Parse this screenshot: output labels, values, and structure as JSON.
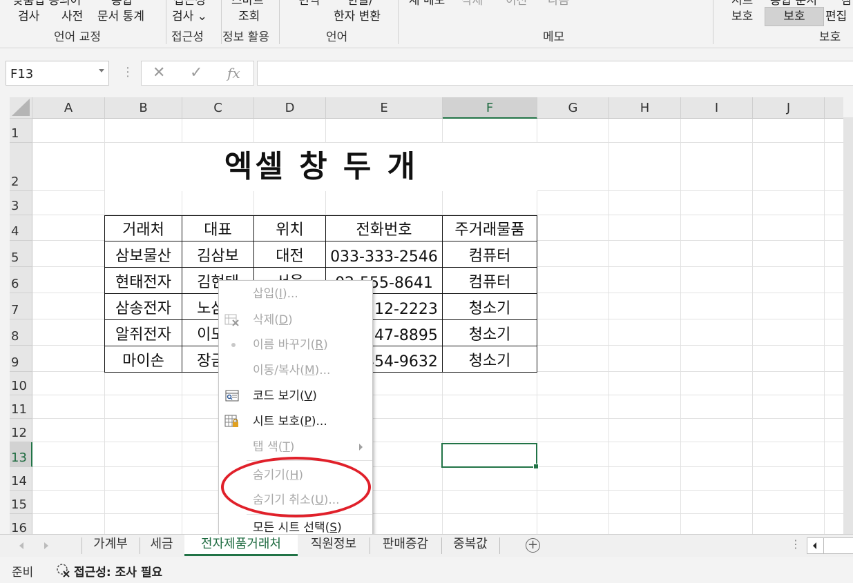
{
  "ribbon": {
    "top_cut": [
      "맞춤법 종의어",
      "통합",
      "접근성",
      "스마트",
      "번역",
      "한글/",
      "새 메모",
      "삭제",
      "이전",
      "다음",
      "시트",
      "통합 문서",
      "잠"
    ],
    "row2": {
      "spell": "검사",
      "thesaurus": "사전",
      "stats": "문서 통계",
      "accessibility": "검사 ⌄",
      "lookup": "조회",
      "hanja": "한자 변환",
      "protect_sheet": "보호",
      "protect_workbook": "보호",
      "edit": "편집"
    },
    "groups": {
      "proofing": "언어 교정",
      "accessibility": "접근성",
      "insights": "정보 활용",
      "language": "언어",
      "comments": "메모",
      "protect": "보호"
    }
  },
  "formula_bar": {
    "name_box": "F13",
    "cancel_icon": "✕",
    "enter_icon": "✓",
    "fx_label": "fx",
    "formula": ""
  },
  "grid": {
    "columns": [
      "A",
      "B",
      "C",
      "D",
      "E",
      "F",
      "G",
      "H",
      "I",
      "J"
    ],
    "rows": [
      "1",
      "2",
      "3",
      "4",
      "5",
      "6",
      "7",
      "8",
      "9",
      "10",
      "11",
      "12",
      "13",
      "14",
      "15",
      "16"
    ],
    "selected_cell": "F13"
  },
  "sheet": {
    "title": "엑셀 창 두 개",
    "headers": [
      "거래처",
      "대표",
      "위치",
      "전화번호",
      "주거래물품"
    ],
    "rows": [
      [
        "삼보물산",
        "김삼보",
        "대전",
        "033-333-2546",
        "컴퓨터"
      ],
      [
        "현태전자",
        "김현태",
        "서울",
        "02-555-8641",
        "컴퓨터"
      ],
      [
        "삼송전자",
        "노삼송",
        "",
        "031-512-2223",
        "청소기"
      ],
      [
        "알쥐전자",
        "이모모",
        "",
        "041-247-8895",
        "청소기"
      ],
      [
        "마이손",
        "장금이",
        "",
        "051-454-9632",
        "청소기"
      ]
    ]
  },
  "context_menu": {
    "items": [
      {
        "label": "삽입",
        "key": "I",
        "suffix": "...",
        "enabled": false,
        "icon": ""
      },
      {
        "label": "삭제",
        "key": "D",
        "suffix": "",
        "enabled": false,
        "icon": "delete-sheet-icon"
      },
      {
        "label": "이름 바꾸기",
        "key": "R",
        "suffix": "",
        "enabled": false,
        "icon": "rename-icon"
      },
      {
        "label": "이동/복사",
        "key": "M",
        "suffix": "...",
        "enabled": false,
        "icon": ""
      },
      {
        "label": "코드 보기",
        "key": "V",
        "suffix": "",
        "enabled": true,
        "icon": "view-code-icon"
      },
      {
        "label": "시트 보호",
        "key": "P",
        "suffix": "...",
        "enabled": true,
        "icon": "protect-sheet-icon"
      },
      {
        "label": "탭 색",
        "key": "T",
        "suffix": "",
        "enabled": false,
        "icon": "",
        "submenu": true
      },
      {
        "label": "숨기기",
        "key": "H",
        "suffix": "",
        "enabled": false,
        "icon": ""
      },
      {
        "label": "숨기기 취소",
        "key": "U",
        "suffix": "...",
        "enabled": false,
        "icon": ""
      },
      {
        "label": "모든 시트 선택",
        "key": "S",
        "suffix": "",
        "enabled": true,
        "icon": ""
      }
    ]
  },
  "tabs": [
    "가계부",
    "세금",
    "전자제품거래처",
    "직원정보",
    "판매증감",
    "중복값"
  ],
  "active_tab": "전자제품거래처",
  "add_sheet": "+",
  "status": {
    "ready": "준비",
    "accessibility": "접근성: 조사 필요"
  },
  "colors": {
    "excel_green": "#217346",
    "annotation_red": "#e0202a"
  }
}
